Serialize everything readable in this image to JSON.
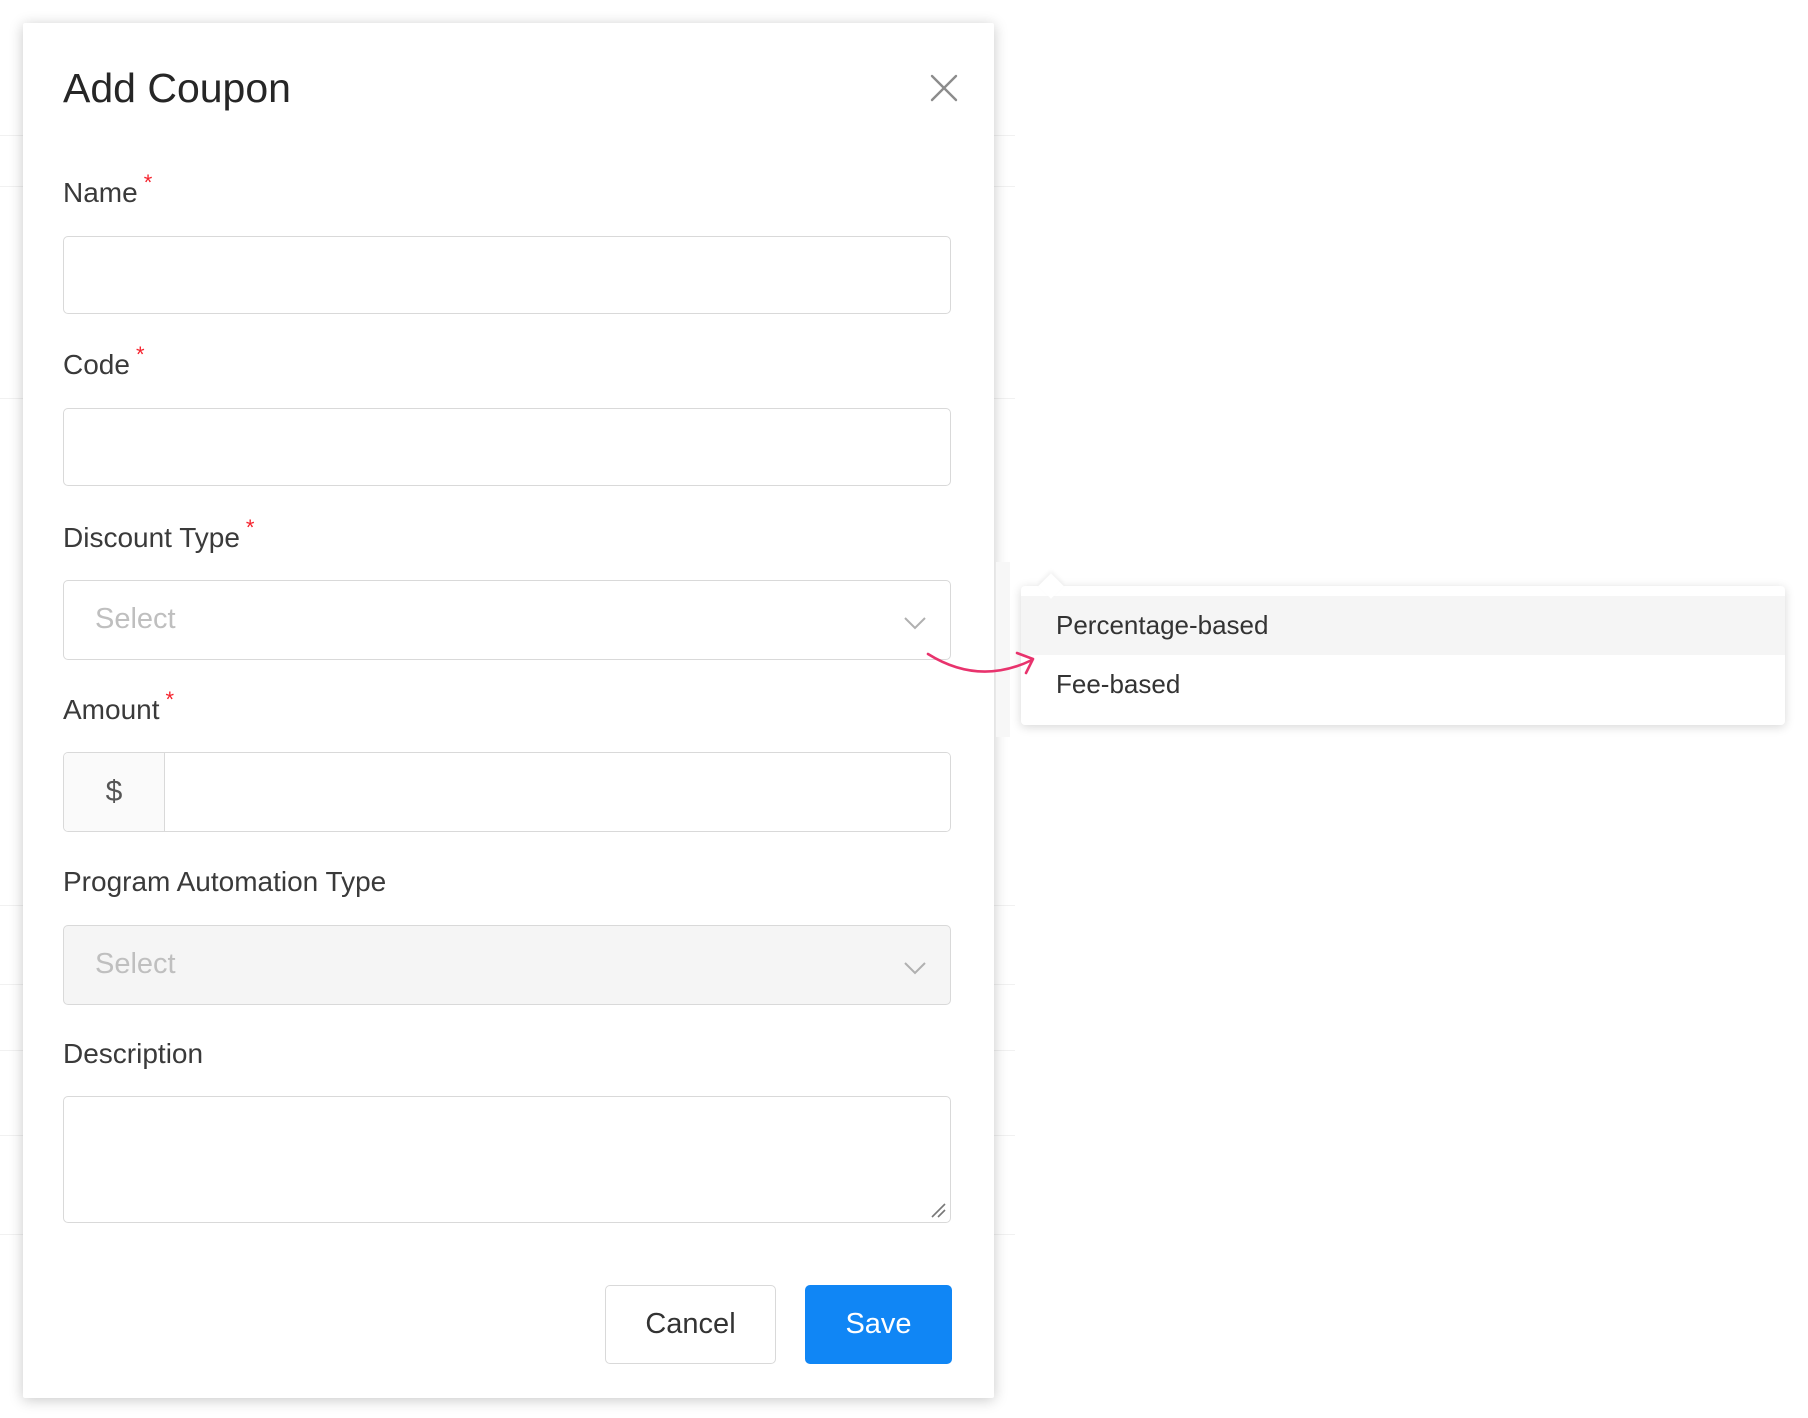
{
  "modal": {
    "title": "Add Coupon",
    "close_icon": "close-icon"
  },
  "fields": {
    "name": {
      "label": "Name",
      "required_mark": "*",
      "value": ""
    },
    "code": {
      "label": "Code",
      "required_mark": "*",
      "value": ""
    },
    "discount_type": {
      "label": "Discount Type",
      "required_mark": "*",
      "placeholder": "Select",
      "icon": "chevron-down-icon"
    },
    "amount": {
      "label": "Amount",
      "required_mark": "*",
      "prefix": "$",
      "value": ""
    },
    "program_automation_type": {
      "label": "Program Automation Type",
      "placeholder": "Select",
      "disabled": true,
      "icon": "chevron-down-icon"
    },
    "description": {
      "label": "Description",
      "value": ""
    }
  },
  "footer": {
    "cancel_label": "Cancel",
    "save_label": "Save"
  },
  "dropdown": {
    "options": [
      {
        "label": "Percentage-based",
        "highlighted": true
      },
      {
        "label": "Fee-based",
        "highlighted": false
      }
    ]
  },
  "colors": {
    "primary": "#1086f5",
    "required": "#f5222d",
    "annotation_arrow": "#e8336d"
  }
}
